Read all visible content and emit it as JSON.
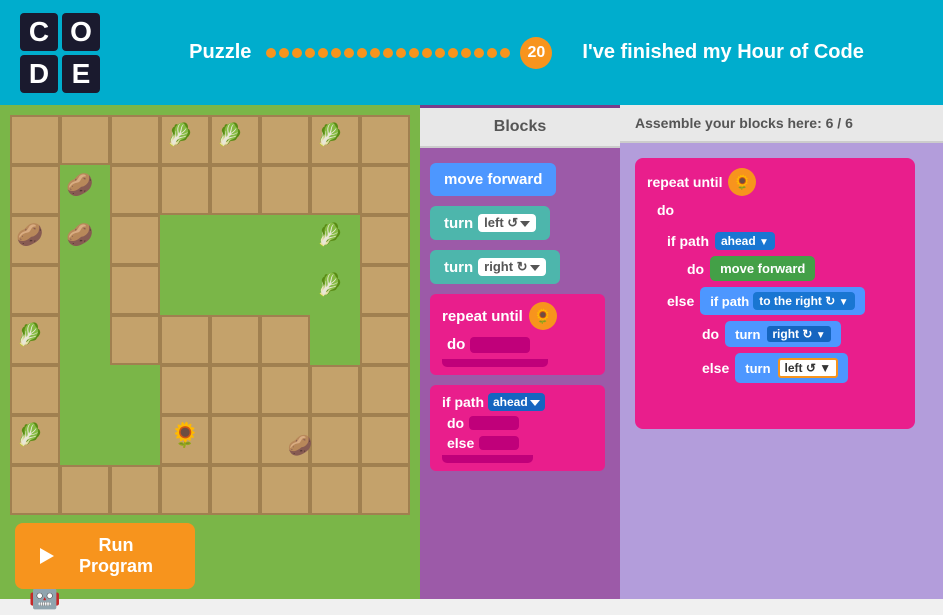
{
  "header": {
    "logo": {
      "cells": [
        "C",
        "O",
        "D",
        "E"
      ]
    },
    "puzzle_label": "Puzzle",
    "puzzle_number": "20",
    "total_dots": 20,
    "finished_text": "I've finished my Hour of Code"
  },
  "blocks_panel": {
    "header": "Blocks",
    "blocks": [
      {
        "id": "move-forward",
        "label": "move forward",
        "type": "blue"
      },
      {
        "id": "turn-left",
        "label": "turn",
        "modifier": "left",
        "type": "teal"
      },
      {
        "id": "turn-right",
        "label": "turn",
        "modifier": "right ↺",
        "type": "teal"
      },
      {
        "id": "repeat-until",
        "label": "repeat until",
        "type": "pink"
      },
      {
        "id": "if-path",
        "label": "if path",
        "modifier": "ahead",
        "type": "pink"
      }
    ]
  },
  "assemble_panel": {
    "header": "Assemble your blocks here: 6 / 6"
  },
  "run_button": {
    "label": "Run Program"
  }
}
